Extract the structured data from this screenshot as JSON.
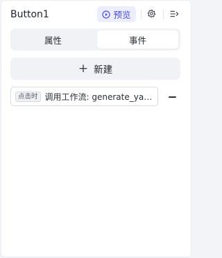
{
  "header": {
    "title": "Button1",
    "preview_label": "预览",
    "icons": [
      "play-circle-icon",
      "gear-icon",
      "collapse-panel-icon"
    ],
    "accent_color": "#4f4fe0"
  },
  "tabs": [
    {
      "label": "属性",
      "active": false
    },
    {
      "label": "事件",
      "active": true
    }
  ],
  "new_button": {
    "icon": "plus-icon",
    "label": "新建"
  },
  "events": [
    {
      "trigger": "点击时",
      "action": "调用工作流: generate_yanj…",
      "remove_icon": "minus-icon"
    }
  ]
}
